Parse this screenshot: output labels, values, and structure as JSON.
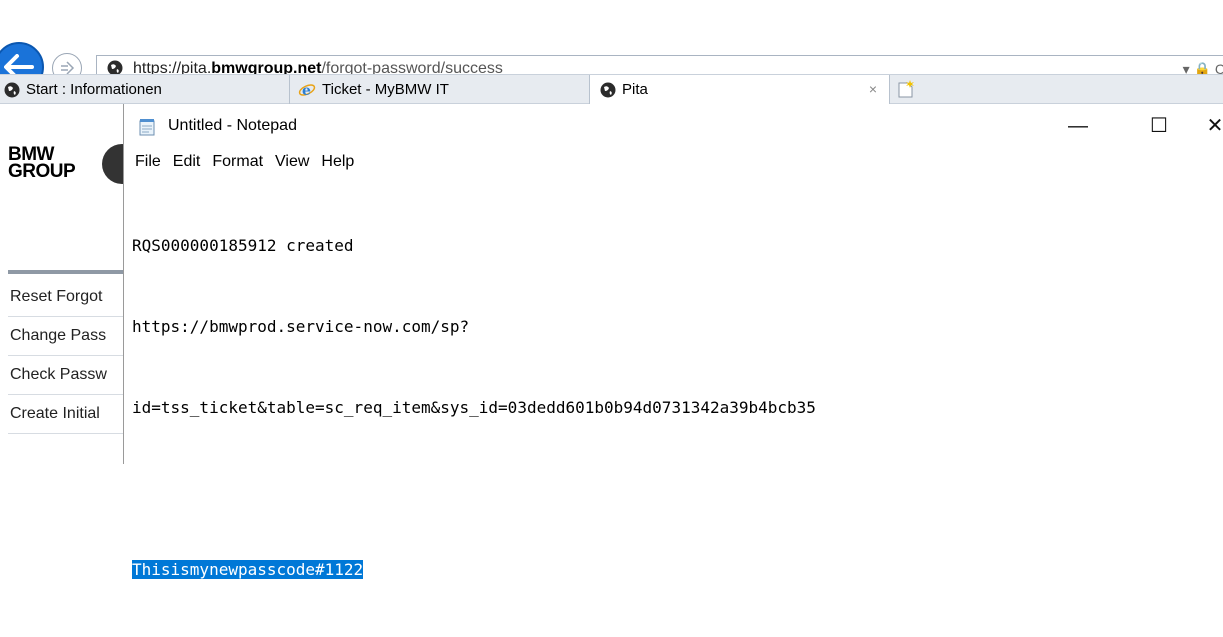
{
  "browser": {
    "url_scheme": "https://pita.",
    "url_domain": "bmwgroup.net",
    "url_path": "/forgot-password/success",
    "url_tools": "▾ 🔒 C"
  },
  "tabs": [
    {
      "label": "Start : Informationen",
      "icon": "globe-icon"
    },
    {
      "label": "Ticket - MyBMW IT",
      "icon": "ie-icon"
    },
    {
      "label": "Pita",
      "icon": "globe-icon",
      "close": "×"
    }
  ],
  "page": {
    "logo_line1": "BMW",
    "logo_line2": "GROUP",
    "nav": [
      "Reset Forgot",
      "Change Pass",
      "Check Passw",
      "Create Initial"
    ]
  },
  "notepad": {
    "title": "Untitled - Notepad",
    "controls": {
      "minimize": "—",
      "maximize": "☐",
      "close": "✕"
    },
    "menu": [
      "File",
      "Edit",
      "Format",
      "View",
      "Help"
    ],
    "lines": [
      "RQS000000185912 created",
      "https://bmwprod.service-now.com/sp?",
      "id=tss_ticket&table=sc_req_item&sys_id=03dedd601b0b94d0731342a39b4bcb35",
      ""
    ],
    "selected_line": "Thisismynewpasscode#1122",
    "colors": {
      "selection": "#0078d7"
    }
  }
}
